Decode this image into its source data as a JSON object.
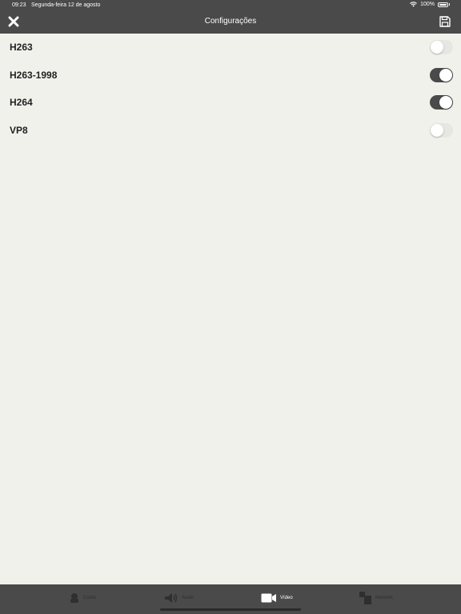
{
  "status_bar": {
    "time": "09:23",
    "date": "Segunda-feira 12 de agosto",
    "battery": "100%",
    "icons": [
      "wifi-icon",
      "battery-icon"
    ]
  },
  "nav": {
    "title": "Configurações",
    "close_icon": "close-icon",
    "save_icon": "save-icon"
  },
  "codecs": [
    {
      "label": "H263",
      "enabled": false
    },
    {
      "label": "H263-1998",
      "enabled": true
    },
    {
      "label": "H264",
      "enabled": true
    },
    {
      "label": "VP8",
      "enabled": false
    }
  ],
  "tabs": [
    {
      "label": "Conta",
      "icon": "account-icon",
      "active": false
    },
    {
      "label": "Áudio",
      "icon": "speaker-icon",
      "active": false
    },
    {
      "label": "Vídeo",
      "icon": "video-camera-icon",
      "active": true
    },
    {
      "label": "Network",
      "icon": "network-icon",
      "active": false
    }
  ],
  "colors": {
    "bar": "#4a4a4a",
    "background": "#f1f1ec",
    "toggle_on": "#4a4a4a",
    "toggle_off": "#e6e6e2"
  }
}
